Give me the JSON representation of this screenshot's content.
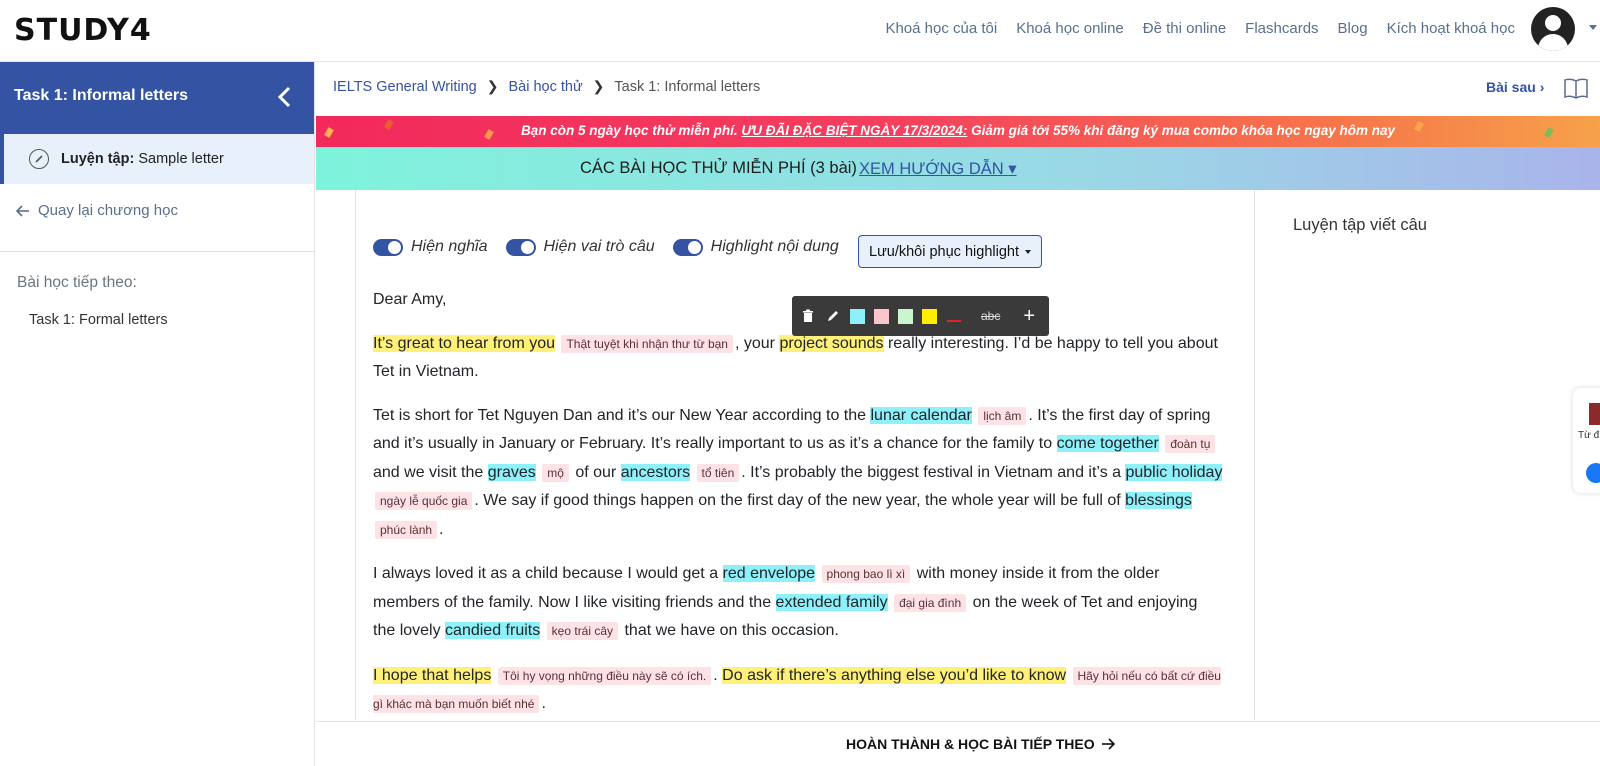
{
  "header": {
    "logo": "STUDY4",
    "nav": [
      "Khoá học của tôi",
      "Khoá học online",
      "Đề thi online",
      "Flashcards",
      "Blog",
      "Kích hoạt khoá học"
    ]
  },
  "sidebar": {
    "title": "Task 1: Informal letters",
    "current_prefix": "Luyện tập:",
    "current_label": "Sample letter",
    "back_label": "Quay lại chương học",
    "next_title": "Bài học tiếp theo:",
    "next_item": "Task 1: Formal letters"
  },
  "breadcrumb": {
    "items": [
      "IELTS General Writing",
      "Bài học thử",
      "Task 1: Informal letters"
    ],
    "next_label": "Bài sau"
  },
  "promo": {
    "text_before": "Bạn còn 5 ngày học thử miễn phí.",
    "text_underlined": "ƯU ĐÃI ĐẶC BIỆT NGÀY 17/3/2024:",
    "text_after": "Giảm giá tới 55% khi đăng ký mua combo khóa học ngay hôm nay"
  },
  "free_lessons": {
    "text": "CÁC BÀI HỌC THỬ MIỄN PHÍ (3 bài)",
    "link": "XEM HƯỚNG DẪN"
  },
  "toggles": [
    "Hiện nghĩa",
    "Hiện vai trò câu",
    "Highlight nội dung"
  ],
  "save_highlight_label": "Lưu/khôi phục highlight",
  "toolbar": {
    "colors": [
      "#8ef0f8",
      "#f9c4cc",
      "#c9f5cf",
      "#ffee00"
    ],
    "strike_label": "abc",
    "plus_label": "+"
  },
  "right_panel_title": "Luyện tập viết câu",
  "essay": {
    "greeting": "Dear Amy,",
    "p1": {
      "h1": "It’s great to hear from you",
      "t1": "Thật tuyệt khi nhận thư từ bạn",
      "s1": ", your",
      "h2": "project sounds",
      "s2": "really interesting. I’d be happy to tell you about Tet in Vietnam."
    },
    "p2": {
      "s1": "Tet is short for Tet Nguyen Dan and it’s our New Year according to the",
      "h1": "lunar calendar",
      "t1": "lịch âm",
      "s2": ". It’s the first day of spring and it’s usually in January or February. It’s really important to us as it’s a chance for the family to",
      "h2": "come together",
      "t2": "đoàn tụ",
      "s3": "and we visit the",
      "h3": "graves",
      "t3": "mộ",
      "s4": "of our",
      "h4": "ancestors",
      "t4": "tổ tiên",
      "s5": ". It’s probably the biggest festival in Vietnam and it’s a",
      "h5": "public holiday",
      "t5": "ngày lễ quốc gia",
      "s6": ". We say if good things happen on the first day of the new year, the whole year will be full of",
      "h6": "blessings",
      "t6": "phúc lành",
      "s7": "."
    },
    "p3": {
      "s1": "I always loved it as a child because I would get a",
      "h1": "red envelope",
      "t1": "phong bao lì xì",
      "s2": "with money inside it from the older members of the family. Now I like visiting friends and the",
      "h2": "extended family",
      "t2": "đại gia đình",
      "s3": "on the week of Tet and enjoying the lovely",
      "h3": "candied fruits",
      "t3": "kẹo trái cây",
      "s4": "that we have on this occasion."
    },
    "p4": {
      "h1": "I hope that helps",
      "t1": "Tôi hy vọng những điều này sẽ có ích.",
      "s1": ".",
      "h2": "Do ask if there’s anything else you’d like to know",
      "t2": "Hãy hỏi nếu có bất cứ điều gì khác mà bạn muốn biết nhé",
      "s2": "."
    }
  },
  "finish_label": "HOÀN THÀNH & HỌC BÀI TIẾP THEO",
  "float_widget_label": "Từ đ"
}
